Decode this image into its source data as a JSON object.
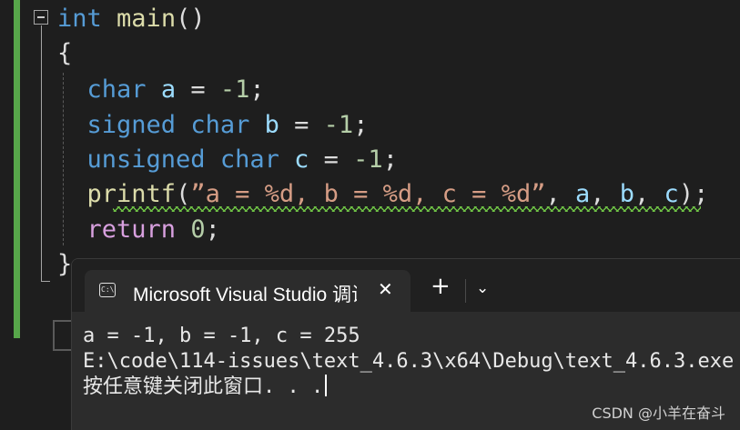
{
  "editor": {
    "lines": {
      "l1": {
        "kw": "int",
        "fn": "main",
        "rest": "()"
      },
      "l2": {
        "brace": "{"
      },
      "l3": {
        "kw": "char",
        "var": "a",
        "eq": " = ",
        "num": "-1",
        "semi": ";"
      },
      "l4": {
        "kw1": "signed",
        "kw2": "char",
        "var": "b",
        "eq": " = ",
        "num": "-1",
        "semi": ";"
      },
      "l5": {
        "kw1": "unsigned",
        "kw2": "char",
        "var": "c",
        "eq": " = ",
        "num": "-1",
        "semi": ";"
      },
      "l6": {
        "fn": "printf",
        "open": "(",
        "str": "”a = %d, b = %d, c = %d”",
        "args_sep1": ", ",
        "a": "a",
        "args_sep2": ", ",
        "b": "b",
        "args_sep3": ", ",
        "c": "c",
        "close": ");"
      },
      "l7": {
        "ctl": "return",
        "num": "0",
        "semi": ";"
      },
      "l8": {
        "brace": "}"
      }
    }
  },
  "terminal": {
    "tab_icon_text": "C:\\",
    "tab_title": "Microsoft Visual Studio 调试控制台",
    "close_glyph": "✕",
    "new_tab_glyph": "+",
    "dropdown_glyph": "⌄",
    "output": [
      "a = -1, b = -1, c = 255",
      "E:\\code\\114-issues\\text_4.6.3\\x64\\Debug\\text_4.6.3.exe",
      "按任意键关闭此窗口. . ."
    ]
  },
  "watermark": "CSDN @小羊在奋斗"
}
